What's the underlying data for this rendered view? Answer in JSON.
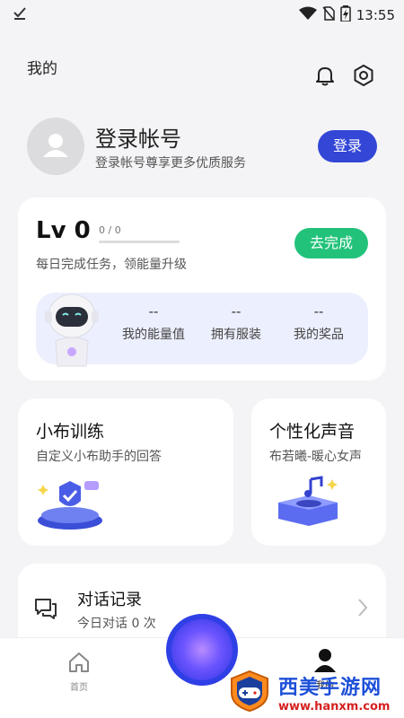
{
  "status_bar": {
    "time": "13:55",
    "left_icon": "check-download-icon",
    "icons": [
      "wifi-icon",
      "no-sim-icon",
      "battery-icon"
    ]
  },
  "header": {
    "title": "我的",
    "icons": [
      "bell-icon",
      "settings-icon"
    ]
  },
  "profile": {
    "title": "登录帐号",
    "subtitle": "登录帐号尊享更多优质服务",
    "login_button": "登录"
  },
  "level": {
    "level_label": "Lv 0",
    "progress_text": "0 / 0",
    "progress_fraction": 0,
    "description": "每日完成任务，领能量升级",
    "task_button": "去完成",
    "stats": [
      {
        "value": "--",
        "label": "我的能量值"
      },
      {
        "value": "--",
        "label": "拥有服装"
      },
      {
        "value": "--",
        "label": "我的奖品"
      }
    ]
  },
  "features": [
    {
      "title": "小布训练",
      "subtitle": "自定义小布助手的回答",
      "icon": "training-shield-icon"
    },
    {
      "title": "个性化声音",
      "subtitle": "布若曦-暖心女声",
      "icon": "music-player-icon"
    }
  ],
  "history": {
    "title": "对话记录",
    "subtitle": "今日对话 0 次"
  },
  "tabbar": {
    "home_label": "首页",
    "me_label": "我的"
  },
  "watermark": {
    "title": "西美手游网",
    "url": "www.hanxm.com"
  },
  "colors": {
    "primary": "#3346d6",
    "success": "#22c27a",
    "panel": "#eceffd"
  }
}
